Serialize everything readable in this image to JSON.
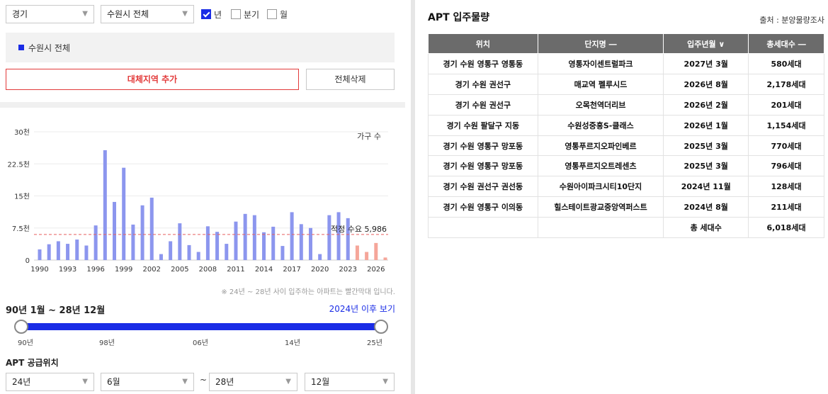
{
  "filters": {
    "province": "경기",
    "city": "수원시 전체",
    "period_options": [
      {
        "label": "년",
        "checked": true
      },
      {
        "label": "분기",
        "checked": false
      },
      {
        "label": "월",
        "checked": false
      }
    ]
  },
  "region_tag": "수원시 전체",
  "buttons": {
    "add_region": "대체지역 추가",
    "delete_all": "전체삭제"
  },
  "chart_data": {
    "type": "bar",
    "ylabel_note": "가구 수",
    "y_ticks": [
      "30천",
      "22.5천",
      "15천",
      "7.5천",
      "0"
    ],
    "ylim": [
      0,
      30000
    ],
    "x_tick_labels": [
      "1990",
      "1993",
      "1996",
      "1999",
      "2002",
      "2005",
      "2008",
      "2011",
      "2014",
      "2017",
      "2020",
      "2023",
      "2026"
    ],
    "years": [
      1990,
      1991,
      1992,
      1993,
      1994,
      1995,
      1996,
      1997,
      1998,
      1999,
      2000,
      2001,
      2002,
      2003,
      2004,
      2005,
      2006,
      2007,
      2008,
      2009,
      2010,
      2011,
      2012,
      2013,
      2014,
      2015,
      2016,
      2017,
      2018,
      2019,
      2020,
      2021,
      2022,
      2023,
      2024,
      2025,
      2026,
      2027
    ],
    "values": [
      2500,
      3700,
      4400,
      3800,
      4800,
      3400,
      8100,
      25700,
      13600,
      21600,
      8300,
      12800,
      14600,
      1400,
      4400,
      8600,
      3500,
      1900,
      7900,
      6600,
      3800,
      9000,
      10800,
      10500,
      6500,
      7800,
      3300,
      11200,
      8400,
      7500,
      1400,
      10500,
      11200,
      9800,
      3400,
      1900,
      4000,
      600
    ],
    "projected_from_year": 2024,
    "reference_line": {
      "label": "적정 수요 5,986",
      "value": 5986
    },
    "colors": {
      "actual": "#8c96ee",
      "projected": "#f5a69a",
      "reference": "#e86060"
    }
  },
  "chart_note": "※ 24년 ~ 28년 사이 입주하는 아파트는 빨간막대 입니다.",
  "range": {
    "title": "90년 1월 ~ 28년 12월",
    "link": "2024년 이후 보기",
    "ticks": [
      "90년",
      "98년",
      "06년",
      "14년",
      "25년"
    ]
  },
  "supply": {
    "title": "APT 공급위치",
    "from_year": "24년",
    "from_month": "6월",
    "to_year": "28년",
    "to_month": "12월",
    "separator": "~"
  },
  "right": {
    "title": "APT 입주물량",
    "source": "출처 : 분양물량조사",
    "headers": [
      "위치",
      "단지명 ―",
      "입주년월 ∨",
      "총세대수 ―"
    ],
    "rows": [
      [
        "경기 수원 영통구 영통동",
        "영통자이센트럴파크",
        "2027년 3월",
        "580세대"
      ],
      [
        "경기 수원 권선구",
        "매교역 펠루시드",
        "2026년 8월",
        "2,178세대"
      ],
      [
        "경기 수원 권선구",
        "오목천역더리브",
        "2026년 2월",
        "201세대"
      ],
      [
        "경기 수원 팔달구 지동",
        "수원성중흥S-클래스",
        "2026년 1월",
        "1,154세대"
      ],
      [
        "경기 수원 영통구 망포동",
        "영통푸르지오파인베르",
        "2025년 3월",
        "770세대"
      ],
      [
        "경기 수원 영통구 망포동",
        "영통푸르지오트레센츠",
        "2025년 3월",
        "796세대"
      ],
      [
        "경기 수원 권선구 권선동",
        "수원아이파크시티10단지",
        "2024년 11월",
        "128세대"
      ],
      [
        "경기 수원 영통구 이의동",
        "힐스테이트광교중앙역퍼스트",
        "2024년 8월",
        "211세대"
      ]
    ],
    "total_label": "총 세대수",
    "total_value": "6,018세대"
  }
}
